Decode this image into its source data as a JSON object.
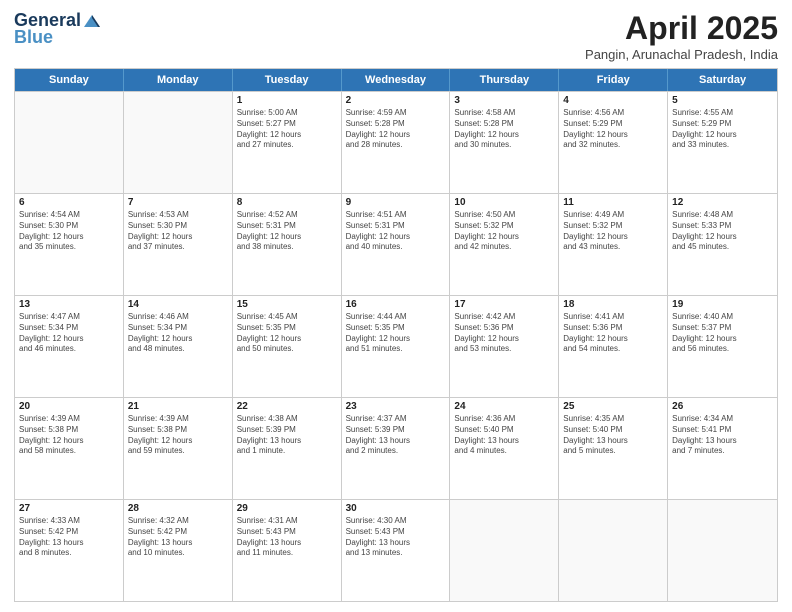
{
  "header": {
    "logo_general": "General",
    "logo_blue": "Blue",
    "title": "April 2025",
    "subtitle": "Pangin, Arunachal Pradesh, India"
  },
  "calendar": {
    "days_of_week": [
      "Sunday",
      "Monday",
      "Tuesday",
      "Wednesday",
      "Thursday",
      "Friday",
      "Saturday"
    ],
    "weeks": [
      [
        {
          "day": "",
          "info": ""
        },
        {
          "day": "",
          "info": ""
        },
        {
          "day": "1",
          "info": "Sunrise: 5:00 AM\nSunset: 5:27 PM\nDaylight: 12 hours\nand 27 minutes."
        },
        {
          "day": "2",
          "info": "Sunrise: 4:59 AM\nSunset: 5:28 PM\nDaylight: 12 hours\nand 28 minutes."
        },
        {
          "day": "3",
          "info": "Sunrise: 4:58 AM\nSunset: 5:28 PM\nDaylight: 12 hours\nand 30 minutes."
        },
        {
          "day": "4",
          "info": "Sunrise: 4:56 AM\nSunset: 5:29 PM\nDaylight: 12 hours\nand 32 minutes."
        },
        {
          "day": "5",
          "info": "Sunrise: 4:55 AM\nSunset: 5:29 PM\nDaylight: 12 hours\nand 33 minutes."
        }
      ],
      [
        {
          "day": "6",
          "info": "Sunrise: 4:54 AM\nSunset: 5:30 PM\nDaylight: 12 hours\nand 35 minutes."
        },
        {
          "day": "7",
          "info": "Sunrise: 4:53 AM\nSunset: 5:30 PM\nDaylight: 12 hours\nand 37 minutes."
        },
        {
          "day": "8",
          "info": "Sunrise: 4:52 AM\nSunset: 5:31 PM\nDaylight: 12 hours\nand 38 minutes."
        },
        {
          "day": "9",
          "info": "Sunrise: 4:51 AM\nSunset: 5:31 PM\nDaylight: 12 hours\nand 40 minutes."
        },
        {
          "day": "10",
          "info": "Sunrise: 4:50 AM\nSunset: 5:32 PM\nDaylight: 12 hours\nand 42 minutes."
        },
        {
          "day": "11",
          "info": "Sunrise: 4:49 AM\nSunset: 5:32 PM\nDaylight: 12 hours\nand 43 minutes."
        },
        {
          "day": "12",
          "info": "Sunrise: 4:48 AM\nSunset: 5:33 PM\nDaylight: 12 hours\nand 45 minutes."
        }
      ],
      [
        {
          "day": "13",
          "info": "Sunrise: 4:47 AM\nSunset: 5:34 PM\nDaylight: 12 hours\nand 46 minutes."
        },
        {
          "day": "14",
          "info": "Sunrise: 4:46 AM\nSunset: 5:34 PM\nDaylight: 12 hours\nand 48 minutes."
        },
        {
          "day": "15",
          "info": "Sunrise: 4:45 AM\nSunset: 5:35 PM\nDaylight: 12 hours\nand 50 minutes."
        },
        {
          "day": "16",
          "info": "Sunrise: 4:44 AM\nSunset: 5:35 PM\nDaylight: 12 hours\nand 51 minutes."
        },
        {
          "day": "17",
          "info": "Sunrise: 4:42 AM\nSunset: 5:36 PM\nDaylight: 12 hours\nand 53 minutes."
        },
        {
          "day": "18",
          "info": "Sunrise: 4:41 AM\nSunset: 5:36 PM\nDaylight: 12 hours\nand 54 minutes."
        },
        {
          "day": "19",
          "info": "Sunrise: 4:40 AM\nSunset: 5:37 PM\nDaylight: 12 hours\nand 56 minutes."
        }
      ],
      [
        {
          "day": "20",
          "info": "Sunrise: 4:39 AM\nSunset: 5:38 PM\nDaylight: 12 hours\nand 58 minutes."
        },
        {
          "day": "21",
          "info": "Sunrise: 4:39 AM\nSunset: 5:38 PM\nDaylight: 12 hours\nand 59 minutes."
        },
        {
          "day": "22",
          "info": "Sunrise: 4:38 AM\nSunset: 5:39 PM\nDaylight: 13 hours\nand 1 minute."
        },
        {
          "day": "23",
          "info": "Sunrise: 4:37 AM\nSunset: 5:39 PM\nDaylight: 13 hours\nand 2 minutes."
        },
        {
          "day": "24",
          "info": "Sunrise: 4:36 AM\nSunset: 5:40 PM\nDaylight: 13 hours\nand 4 minutes."
        },
        {
          "day": "25",
          "info": "Sunrise: 4:35 AM\nSunset: 5:40 PM\nDaylight: 13 hours\nand 5 minutes."
        },
        {
          "day": "26",
          "info": "Sunrise: 4:34 AM\nSunset: 5:41 PM\nDaylight: 13 hours\nand 7 minutes."
        }
      ],
      [
        {
          "day": "27",
          "info": "Sunrise: 4:33 AM\nSunset: 5:42 PM\nDaylight: 13 hours\nand 8 minutes."
        },
        {
          "day": "28",
          "info": "Sunrise: 4:32 AM\nSunset: 5:42 PM\nDaylight: 13 hours\nand 10 minutes."
        },
        {
          "day": "29",
          "info": "Sunrise: 4:31 AM\nSunset: 5:43 PM\nDaylight: 13 hours\nand 11 minutes."
        },
        {
          "day": "30",
          "info": "Sunrise: 4:30 AM\nSunset: 5:43 PM\nDaylight: 13 hours\nand 13 minutes."
        },
        {
          "day": "",
          "info": ""
        },
        {
          "day": "",
          "info": ""
        },
        {
          "day": "",
          "info": ""
        }
      ]
    ]
  }
}
